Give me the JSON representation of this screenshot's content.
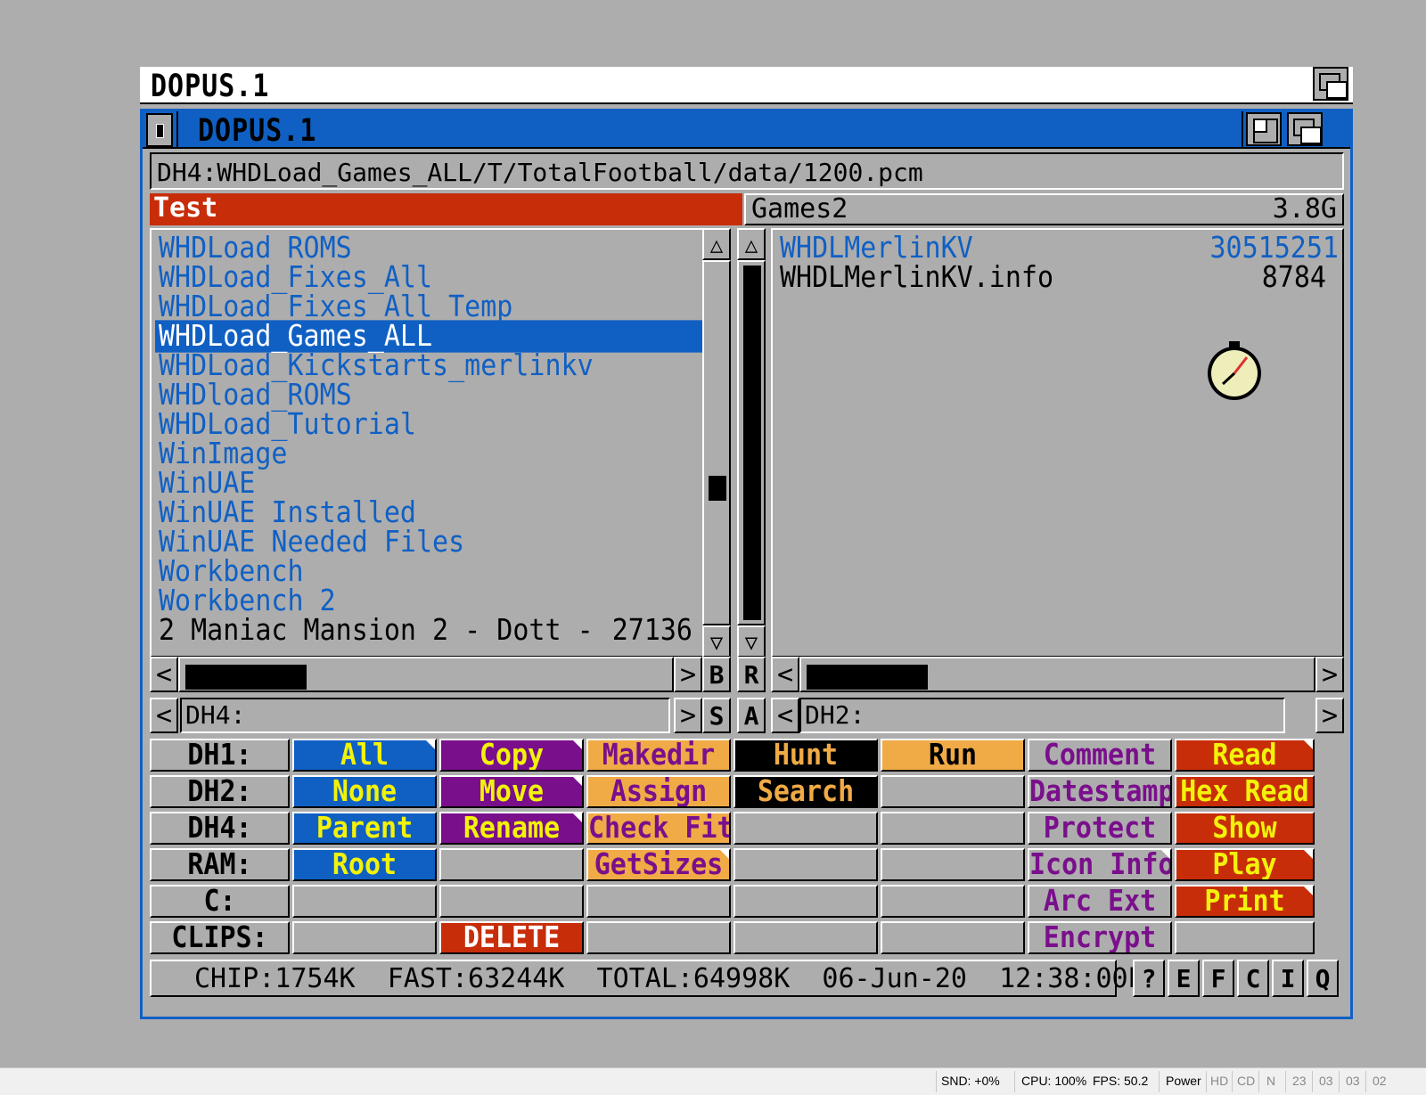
{
  "screen_title": "DOPUS.1",
  "window_title": "DOPUS.1",
  "path": "DH4:WHDLoad_Games_ALL/T/TotalFootball/data/1200.pcm",
  "left_panel": {
    "title": "Test",
    "items": [
      {
        "name": "WHDLoad ROMS",
        "type": "dir"
      },
      {
        "name": "WHDLoad_Fixes_All",
        "type": "dir"
      },
      {
        "name": "WHDLoad_Fixes_All_Temp",
        "type": "dir"
      },
      {
        "name": "WHDLoad_Games_ALL",
        "type": "dir",
        "selected": true
      },
      {
        "name": "WHDLoad_Kickstarts_merlinkv",
        "type": "dir"
      },
      {
        "name": "WHDload_ROMS",
        "type": "dir"
      },
      {
        "name": "WHDLoad_Tutorial",
        "type": "dir"
      },
      {
        "name": "WinImage",
        "type": "dir"
      },
      {
        "name": "WinUAE",
        "type": "dir"
      },
      {
        "name": "WinUAE Installed",
        "type": "dir"
      },
      {
        "name": "WinUAE Needed Files",
        "type": "dir"
      },
      {
        "name": "Workbench",
        "type": "dir"
      },
      {
        "name": "Workbench 2",
        "type": "dir"
      },
      {
        "name": "2 Maniac Mansion 2 - Dott -",
        "type": "file",
        "size": "27136"
      }
    ],
    "device": "DH4:"
  },
  "right_panel": {
    "title": "Games2",
    "free": "3.8G",
    "items": [
      {
        "name": "WHDLMerlinKV",
        "type": "dir",
        "size": "30515251"
      },
      {
        "name": "WHDLMerlinKV.info",
        "type": "file",
        "size": "8784"
      }
    ],
    "device": "DH2:"
  },
  "gadgets": {
    "b": "B",
    "r": "R",
    "s": "S",
    "a": "A"
  },
  "button_bank": [
    [
      {
        "label": "DH1:",
        "color": "#adadad",
        "text": "#000000"
      },
      {
        "label": "DH2:",
        "color": "#adadad",
        "text": "#000000"
      },
      {
        "label": "DH4:",
        "color": "#adadad",
        "text": "#000000"
      },
      {
        "label": "RAM:",
        "color": "#adadad",
        "text": "#000000"
      },
      {
        "label": "C:",
        "color": "#adadad",
        "text": "#000000"
      },
      {
        "label": "CLIPS:",
        "color": "#adadad",
        "text": "#000000"
      }
    ],
    [
      {
        "label": "All",
        "color": "#1060c4",
        "text": "#f2f20a",
        "dogear": true
      },
      {
        "label": "None",
        "color": "#1060c4",
        "text": "#f2f20a"
      },
      {
        "label": "Parent",
        "color": "#1060c4",
        "text": "#f2f20a"
      },
      {
        "label": "Root",
        "color": "#1060c4",
        "text": "#f2f20a"
      },
      {
        "label": "",
        "color": "#adadad",
        "text": "#000000"
      },
      {
        "label": "",
        "color": "#adadad",
        "text": "#000000"
      }
    ],
    [
      {
        "label": "Copy",
        "color": "#7a0f8c",
        "text": "#f2f20a",
        "dogear": true
      },
      {
        "label": "Move",
        "color": "#7a0f8c",
        "text": "#f2f20a",
        "dogear": true
      },
      {
        "label": "Rename",
        "color": "#7a0f8c",
        "text": "#f2f20a",
        "dogear": true
      },
      {
        "label": "",
        "color": "#adadad",
        "text": "#000000"
      },
      {
        "label": "",
        "color": "#adadad",
        "text": "#000000"
      },
      {
        "label": "DELETE",
        "color": "#c82d0a",
        "text": "#ffffff"
      }
    ],
    [
      {
        "label": "Makedir",
        "color": "#f0aa46",
        "text": "#7a0f8c"
      },
      {
        "label": "Assign",
        "color": "#f0aa46",
        "text": "#7a0f8c"
      },
      {
        "label": "Check Fit",
        "color": "#f0aa46",
        "text": "#7a0f8c"
      },
      {
        "label": "GetSizes",
        "color": "#f0aa46",
        "text": "#7a0f8c",
        "dogear": true
      },
      {
        "label": "",
        "color": "#adadad",
        "text": "#000000"
      },
      {
        "label": "",
        "color": "#adadad",
        "text": "#000000"
      }
    ],
    [
      {
        "label": "Hunt",
        "color": "#000000",
        "text": "#f0aa46"
      },
      {
        "label": "Search",
        "color": "#000000",
        "text": "#f0aa46"
      },
      {
        "label": "",
        "color": "#adadad",
        "text": "#000000"
      },
      {
        "label": "",
        "color": "#adadad",
        "text": "#000000"
      },
      {
        "label": "",
        "color": "#adadad",
        "text": "#000000"
      },
      {
        "label": "",
        "color": "#adadad",
        "text": "#000000"
      }
    ],
    [
      {
        "label": "Run",
        "color": "#f0aa46",
        "text": "#000000"
      },
      {
        "label": "",
        "color": "#adadad",
        "text": "#000000"
      },
      {
        "label": "",
        "color": "#adadad",
        "text": "#000000"
      },
      {
        "label": "",
        "color": "#adadad",
        "text": "#000000"
      },
      {
        "label": "",
        "color": "#adadad",
        "text": "#000000"
      },
      {
        "label": "",
        "color": "#adadad",
        "text": "#000000"
      }
    ],
    [
      {
        "label": "Comment",
        "color": "#adadad",
        "text": "#7a0f8c"
      },
      {
        "label": "Datestamp",
        "color": "#adadad",
        "text": "#7a0f8c"
      },
      {
        "label": "Protect",
        "color": "#adadad",
        "text": "#7a0f8c"
      },
      {
        "label": "Icon Info",
        "color": "#adadad",
        "text": "#7a0f8c",
        "dogear": true
      },
      {
        "label": "Arc Ext",
        "color": "#adadad",
        "text": "#7a0f8c"
      },
      {
        "label": "Encrypt",
        "color": "#adadad",
        "text": "#7a0f8c"
      }
    ],
    [
      {
        "label": "Read",
        "color": "#c82d0a",
        "text": "#f2f20a",
        "dogear": true
      },
      {
        "label": "Hex Read",
        "color": "#c82d0a",
        "text": "#f2f20a"
      },
      {
        "label": "Show",
        "color": "#c82d0a",
        "text": "#f2f20a"
      },
      {
        "label": "Play",
        "color": "#c82d0a",
        "text": "#f2f20a",
        "dogear": true
      },
      {
        "label": "Print",
        "color": "#c82d0a",
        "text": "#f2f20a",
        "dogear": true
      },
      {
        "label": "",
        "color": "#adadad",
        "text": "#000000"
      }
    ]
  ],
  "status": {
    "text": "CHIP:1754K  FAST:63244K  TOTAL:64998K  06-Jun-20  12:38:00P",
    "buttons": [
      "?",
      "E",
      "F",
      "C",
      "I",
      "Q"
    ]
  },
  "host_status": {
    "snd": "SND: +0%",
    "cpu": "CPU: 100%",
    "fps": "FPS: 50.2",
    "power": "Power",
    "hd": "HD",
    "cd": "CD",
    "n": "N",
    "d1": "23",
    "d2": "03",
    "d3": "03",
    "d4": "02"
  },
  "icons": {
    "scroll_up": "up-arrow-icon",
    "scroll_down": "down-arrow-icon",
    "busy": "stopwatch-icon"
  }
}
